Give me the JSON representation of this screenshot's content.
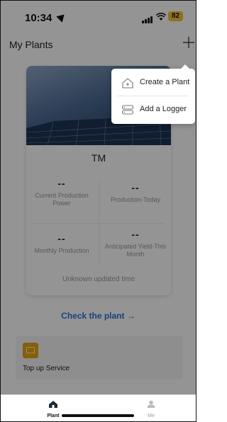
{
  "status_bar": {
    "time": "10:34",
    "battery": "82",
    "battery_color": "#f4c430"
  },
  "header": {
    "title": "My Plants",
    "add_icon": "plus-icon"
  },
  "plant": {
    "name": "TM",
    "stats": [
      {
        "value": "--",
        "label": "Current Production Power"
      },
      {
        "value": "--",
        "label": "Production-Today"
      },
      {
        "value": "--",
        "label": "Monthly Production"
      },
      {
        "value": "--",
        "label": "Anticipated Yield-This Month"
      }
    ],
    "updated": "Unknown updated time"
  },
  "check_link": "Check the plant →",
  "service": {
    "label": "Top up Service",
    "icon": "sim-card-icon",
    "icon_color": "#e6a417"
  },
  "dropdown": {
    "items": [
      {
        "label": "Create a Plant",
        "icon": "house-plus-icon"
      },
      {
        "label": "Add a Logger",
        "icon": "logger-device-icon"
      }
    ]
  },
  "tabbar": {
    "items": [
      {
        "label": "Plant",
        "icon": "home-icon",
        "active": true
      },
      {
        "label": "Me",
        "icon": "person-icon",
        "active": false
      }
    ]
  },
  "colors": {
    "accent_link": "#2d6fd8",
    "overlay": "rgba(0,0,0,0.42)"
  }
}
